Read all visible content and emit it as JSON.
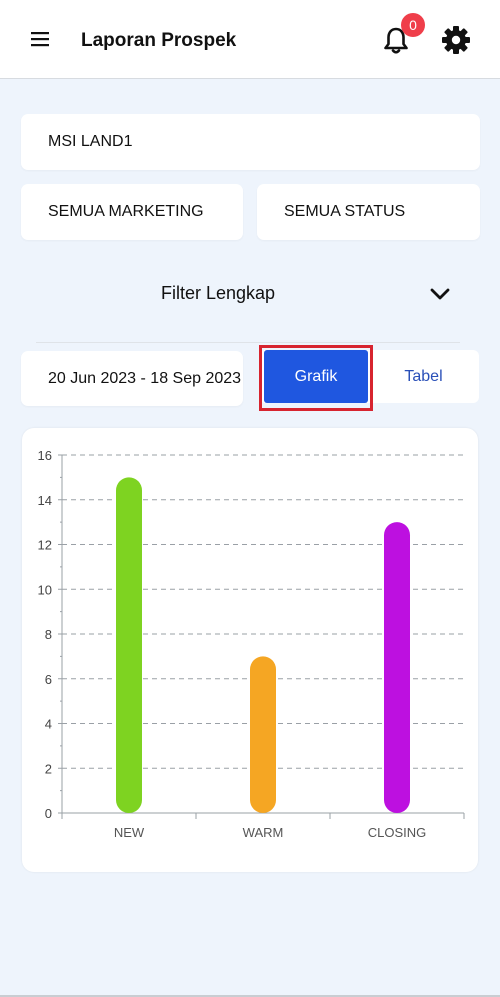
{
  "header": {
    "title": "Laporan Prospek",
    "notification_count": "0"
  },
  "filters": {
    "project": "MSI LAND1",
    "marketing": "SEMUA MARKETING",
    "status": "SEMUA STATUS",
    "advanced_label": "Filter Lengkap",
    "date_range": "20 Jun 2023 - 18 Sep 2023"
  },
  "view_toggle": {
    "grafik_label": "Grafik",
    "tabel_label": "Tabel",
    "active": "Grafik"
  },
  "colors": {
    "accent": "#1f57e0",
    "highlight": "#d7242f",
    "badge": "#ef3e4a"
  },
  "chart_data": {
    "type": "bar",
    "categories": [
      "NEW",
      "WARM",
      "CLOSING"
    ],
    "values": [
      15,
      7,
      13
    ],
    "colors": [
      "#7ed321",
      "#f5a623",
      "#bd10e0"
    ],
    "ylim": [
      0,
      16
    ],
    "yticks": [
      "0",
      "2",
      "4",
      "6",
      "8",
      "10",
      "12",
      "14",
      "16"
    ],
    "grid": true,
    "title": "",
    "xlabel": "",
    "ylabel": ""
  }
}
